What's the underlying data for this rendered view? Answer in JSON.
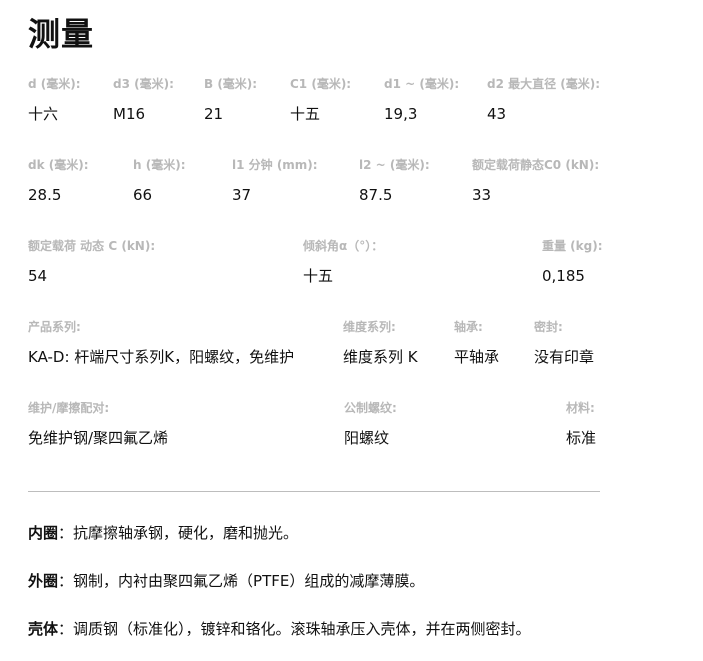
{
  "title": "测量",
  "rows": [
    [
      {
        "label": "d (毫米):",
        "value": "十六"
      },
      {
        "label": "d3 (毫米):",
        "value": "M16"
      },
      {
        "label": "B (毫米):",
        "value": "21"
      },
      {
        "label": "C1 (毫米):",
        "value": "十五"
      },
      {
        "label": "d1 ~ (毫米):",
        "value": "19,3"
      },
      {
        "label": "d2 最大直径 (毫米):",
        "value": "43"
      }
    ],
    [
      {
        "label": "dk (毫米):",
        "value": "28.5"
      },
      {
        "label": "h (毫米):",
        "value": "66"
      },
      {
        "label": "l1 分钟 (mm):",
        "value": "37"
      },
      {
        "label": "l2 ~ (毫米):",
        "value": "87.5"
      },
      {
        "label": "额定载荷静态C0 (kN):",
        "value": "33"
      }
    ],
    [
      {
        "label": "额定载荷 动态 C (kN):",
        "value": "54"
      },
      {
        "label": "倾斜角α（°）：",
        "value": "十五"
      },
      {
        "label": "重量 (kg):",
        "value": "0,185"
      }
    ],
    [
      {
        "label": "产品系列:",
        "value": "KA-D: 杆端尺寸系列K，阳螺纹，免维护"
      },
      {
        "label": "维度系列:",
        "value": "维度系列 K"
      },
      {
        "label": "轴承:",
        "value": "平轴承"
      },
      {
        "label": "密封:",
        "value": "没有印章"
      }
    ],
    [
      {
        "label": "维护/摩擦配对:",
        "value": "免维护钢/聚四氟乙烯"
      },
      {
        "label": "公制螺纹:",
        "value": "阳螺纹"
      },
      {
        "label": "材料:",
        "value": "标准"
      }
    ]
  ],
  "descriptions": [
    {
      "key": "内圈",
      "sep": "：",
      "text": "抗摩擦轴承钢，硬化，磨和抛光。"
    },
    {
      "key": "外圈",
      "sep": "：",
      "text": "钢制，内衬由聚四氟乙烯（PTFE）组成的减摩薄膜。"
    },
    {
      "key": "壳体",
      "sep": "：",
      "text": "调质钢（标准化），镀锌和铬化。滚珠轴承压入壳体，并在两侧密封。"
    }
  ]
}
